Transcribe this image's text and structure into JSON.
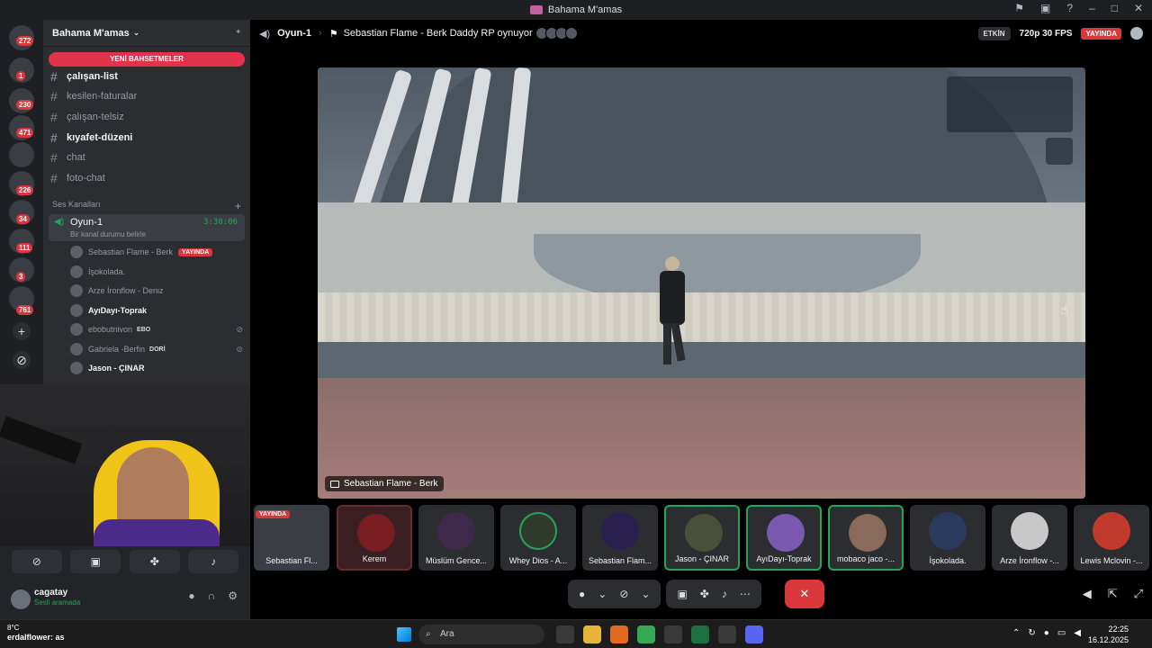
{
  "window": {
    "title": "Bahama M'amas"
  },
  "rail": {
    "badges": [
      "272",
      "1",
      "230",
      "471",
      "226",
      "34",
      "111",
      "3",
      "761"
    ]
  },
  "sidebar": {
    "server_name": "Bahama M'amas",
    "new_mentions": "YENİ BAHSETMELER",
    "channels": [
      {
        "name": "çalışan-list",
        "unread": true
      },
      {
        "name": "kesilen-faturalar",
        "unread": false
      },
      {
        "name": "çalışan-telsiz",
        "unread": false
      },
      {
        "name": "kıyafet-düzeni",
        "unread": true
      },
      {
        "name": "chat",
        "unread": false
      },
      {
        "name": "foto-chat",
        "unread": false
      }
    ],
    "voice_section": "Ses Kanalları",
    "voice_channel": {
      "name": "Oyun-1",
      "timer": "3:30:06",
      "status": "Bir kanal durumu belirle"
    },
    "voice_users": [
      {
        "name": "Sebastian Flame - Berk",
        "live": "YAYINDA",
        "tag": ""
      },
      {
        "name": "İşokolada.",
        "live": "",
        "tag": ""
      },
      {
        "name": "Arze İronflow - Deniz",
        "live": "",
        "tag": ""
      },
      {
        "name": "AyıDayı-Toprak",
        "live": "",
        "tag": ""
      },
      {
        "name": "ebobutnivon",
        "live": "",
        "tag": "EBO"
      },
      {
        "name": "Gabriela -Berfin",
        "live": "",
        "tag": "DORİ"
      },
      {
        "name": "Jason - ÇINAR",
        "live": "",
        "tag": ""
      }
    ]
  },
  "user_panel": {
    "name": "cagatay",
    "status": "Sesli aramada"
  },
  "stage": {
    "channel": "Oyun-1",
    "activity": "Sebastian Flame - Berk Daddy RP oynuyor",
    "etkin": "ETKİN",
    "quality": "720p 30 FPS",
    "live": "YAYINDA",
    "stream_label": "Sebastian Flame - Berk"
  },
  "tiles": [
    {
      "label": "Sebastian Fl...",
      "live": "YAYINDA"
    },
    {
      "label": "Kerem",
      "live": ""
    },
    {
      "label": "Müslüm Gence...",
      "live": ""
    },
    {
      "label": "Whey Dios - A...",
      "live": ""
    },
    {
      "label": "Sebastian Flam...",
      "live": ""
    },
    {
      "label": "Jason - ÇINAR",
      "live": ""
    },
    {
      "label": "AyıDayı-Toprak",
      "live": ""
    },
    {
      "label": "mobaco jaco -...",
      "live": ""
    },
    {
      "label": "İşokolada.",
      "live": ""
    },
    {
      "label": "Arze İronflow -...",
      "live": ""
    },
    {
      "label": "Lewis Mclovin -...",
      "live": ""
    }
  ],
  "taskbar": {
    "temp": "8°C",
    "weather_overlay": "erdalflower: as",
    "search": "Ara",
    "time": "22:25",
    "date": "16.12.2025"
  },
  "colors": {
    "accent_live": "#da373c",
    "speaking_green": "#23a559",
    "sidebar_bg": "#2b2d31"
  }
}
